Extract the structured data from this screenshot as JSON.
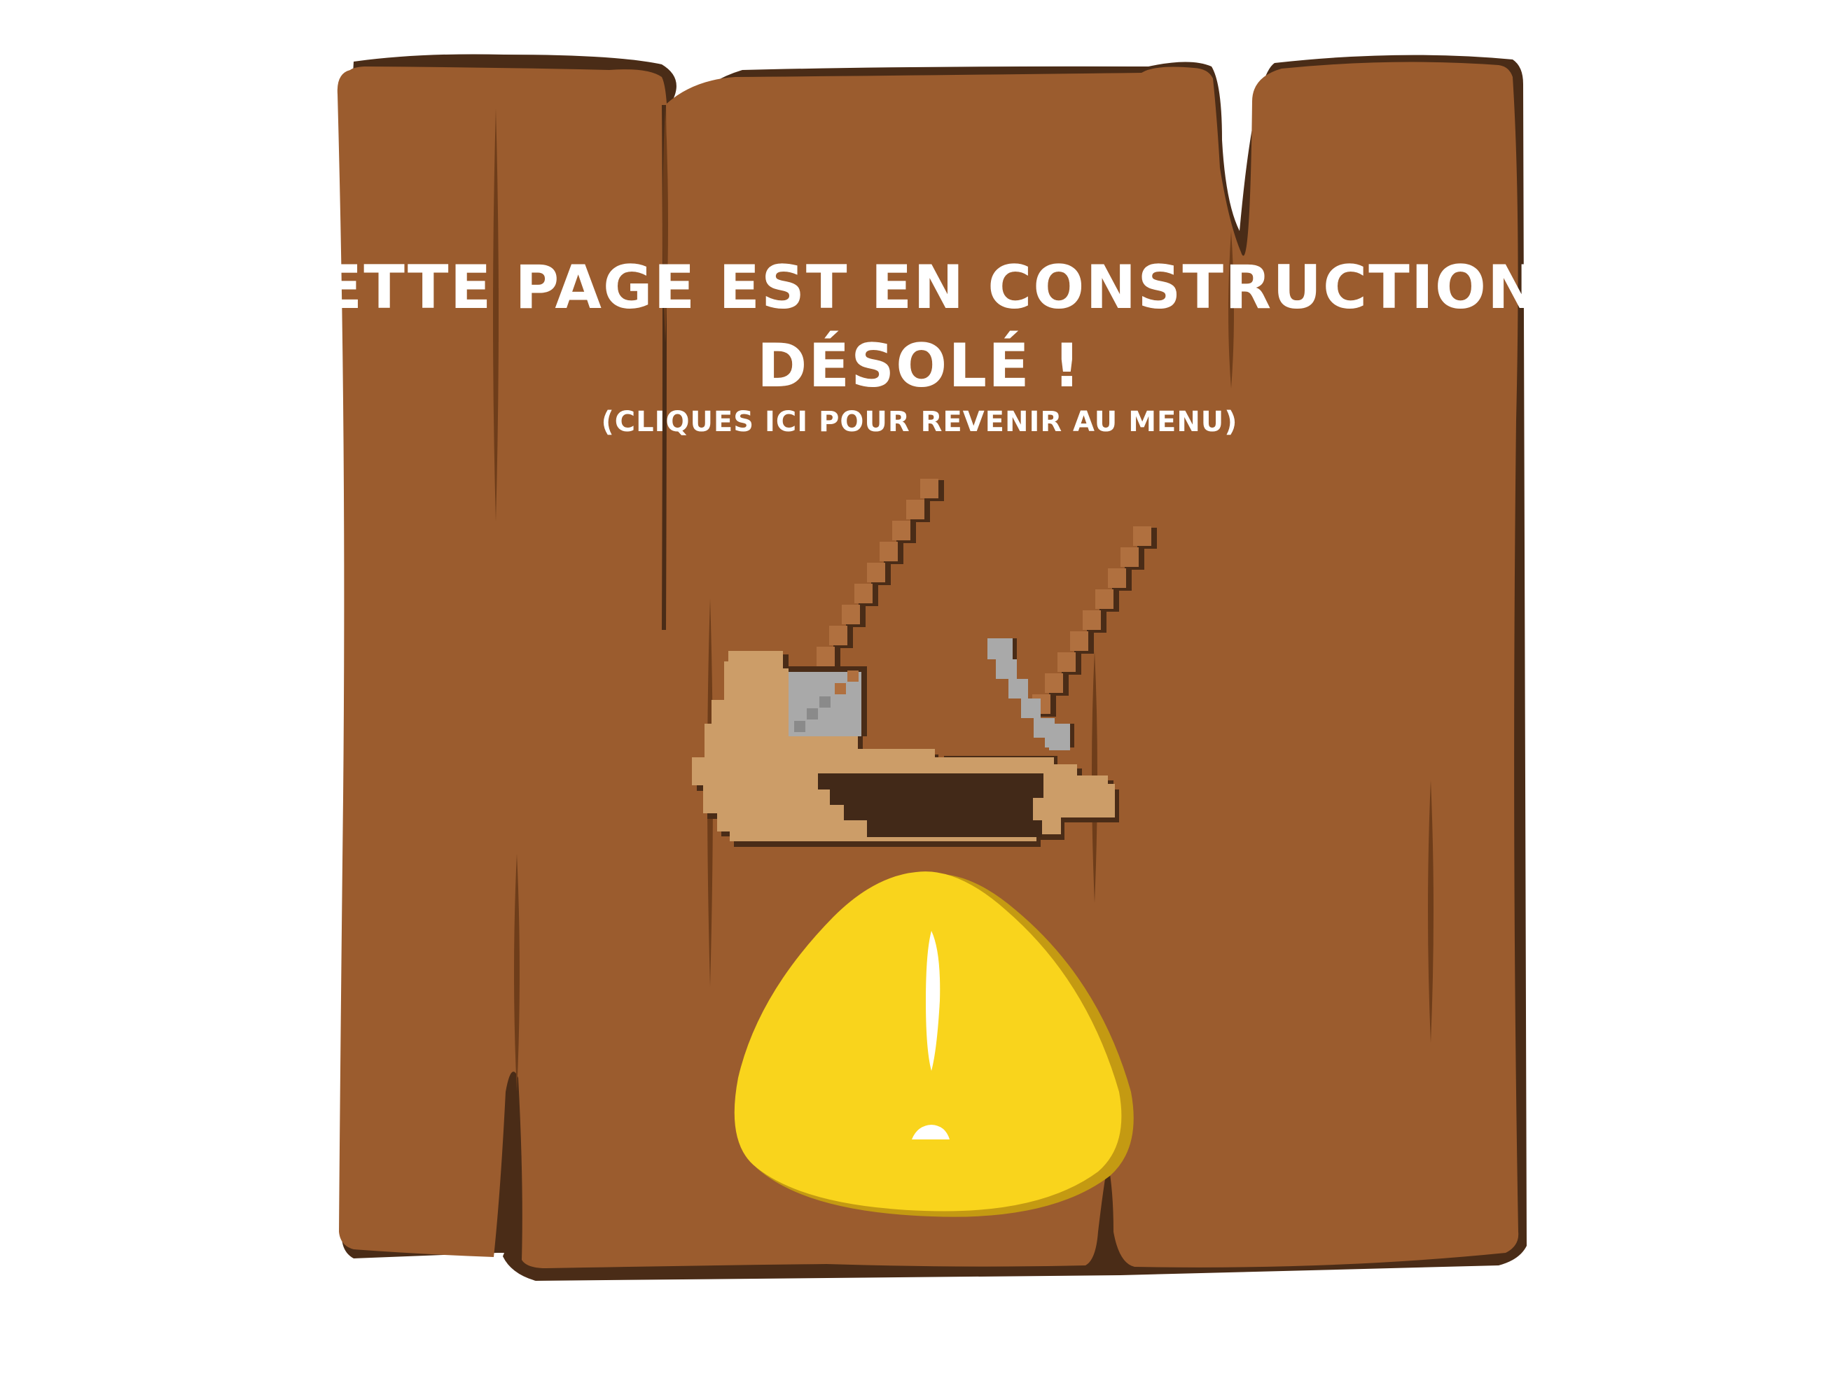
{
  "message": {
    "line1": "Cette page est en construction,",
    "line2": "désolé !"
  },
  "back_link": {
    "label": "(cliques ici pour revenir au menu)"
  },
  "colors": {
    "wood": "#9b5c2e",
    "wood_shadow": "#4a2c17",
    "wood_grain": "#6e3d1a",
    "text": "#ffffff",
    "helmet_light": "#cc9d68",
    "helmet_dark": "#422918",
    "tool_metal": "#a9a9a9",
    "tool_handle": "#b0703f",
    "warning_yellow": "#f9d41c",
    "warning_shadow": "#c49a12"
  },
  "icons": {
    "board": "wooden-sign-board",
    "tools": "construction-helmet-with-tools-icon",
    "warning": "warning-exclamation-icon"
  }
}
